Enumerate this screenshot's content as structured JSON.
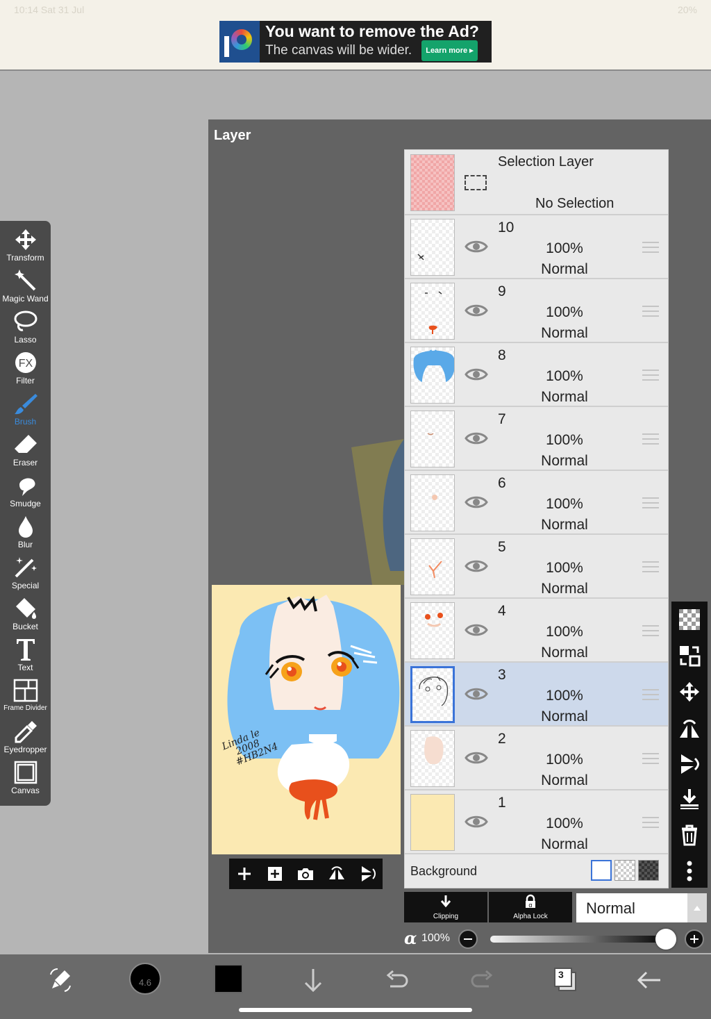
{
  "status": {
    "time": "10:14  Sat 31 Jul",
    "battery": "20%"
  },
  "ad": {
    "title": "You want to remove the Ad?",
    "subtitle": "The canvas will be wider.",
    "learn_more": "Learn more ▸"
  },
  "tools": [
    {
      "label": "Transform",
      "icon": "move-icon"
    },
    {
      "label": "Magic Wand",
      "icon": "magic-wand-icon"
    },
    {
      "label": "Lasso",
      "icon": "lasso-icon"
    },
    {
      "label": "Filter",
      "icon": "fx-icon"
    },
    {
      "label": "Brush",
      "icon": "brush-icon",
      "active": true
    },
    {
      "label": "Eraser",
      "icon": "eraser-icon"
    },
    {
      "label": "Smudge",
      "icon": "smudge-icon"
    },
    {
      "label": "Blur",
      "icon": "drop-icon"
    },
    {
      "label": "Special",
      "icon": "special-icon"
    },
    {
      "label": "Bucket",
      "icon": "bucket-icon"
    },
    {
      "label": "Text",
      "icon": "text-icon"
    },
    {
      "label": "Frame Divider",
      "icon": "frame-divider-icon"
    },
    {
      "label": "Eyedropper",
      "icon": "eyedropper-icon"
    },
    {
      "label": "Canvas",
      "icon": "canvas-icon"
    }
  ],
  "panel": {
    "title": "Layer"
  },
  "preview": {
    "signature_line1": "Linda le",
    "signature_line2": "2008",
    "signature_line3": "#HB2N4"
  },
  "selection_layer": {
    "title": "Selection Layer",
    "status": "No Selection"
  },
  "layers": [
    {
      "num": "10",
      "opacity": "100%",
      "mode": "Normal"
    },
    {
      "num": "9",
      "opacity": "100%",
      "mode": "Normal"
    },
    {
      "num": "8",
      "opacity": "100%",
      "mode": "Normal"
    },
    {
      "num": "7",
      "opacity": "100%",
      "mode": "Normal"
    },
    {
      "num": "6",
      "opacity": "100%",
      "mode": "Normal"
    },
    {
      "num": "5",
      "opacity": "100%",
      "mode": "Normal"
    },
    {
      "num": "4",
      "opacity": "100%",
      "mode": "Normal"
    },
    {
      "num": "3",
      "opacity": "100%",
      "mode": "Normal",
      "selected": true
    },
    {
      "num": "2",
      "opacity": "100%",
      "mode": "Normal"
    },
    {
      "num": "1",
      "opacity": "100%",
      "mode": "Normal"
    }
  ],
  "background": {
    "label": "Background"
  },
  "layer_options": {
    "clipping": "Clipping",
    "alpha_lock": "Alpha Lock",
    "blend_mode": "Normal",
    "alpha_symbol": "α",
    "alpha_value": "100%",
    "alpha_fraction": 1.0
  },
  "bottom": {
    "brush_size": "4.6",
    "layer_count": "3"
  },
  "colors": {
    "accent": "#3a8bdc",
    "selected_row": "#cdd9eb",
    "panel": "#636363",
    "preview_bg": "#fbe9b2",
    "hair": "#7cc0f4",
    "bow": "#e8501c"
  }
}
